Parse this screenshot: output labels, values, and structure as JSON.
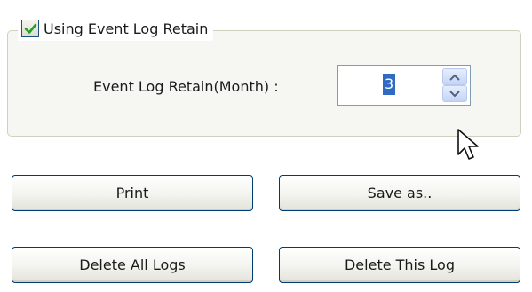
{
  "retention": {
    "checkbox_label": "Using Event Log Retain",
    "checkbox_checked": true,
    "field_label": "Event Log Retain(Month) :",
    "field_value": "3",
    "spin_up_icon": "chevron-up-icon",
    "spin_down_icon": "chevron-down-icon"
  },
  "buttons": {
    "print": "Print",
    "save_as": "Save as..",
    "delete_all": "Delete All Logs",
    "delete_this": "Delete This Log"
  },
  "colors": {
    "checkmark": "#21a121",
    "selection": "#316ac5",
    "button_border": "#003c74",
    "group_border": "#d0d0bf"
  },
  "cursor_icon": "mouse-pointer-icon"
}
